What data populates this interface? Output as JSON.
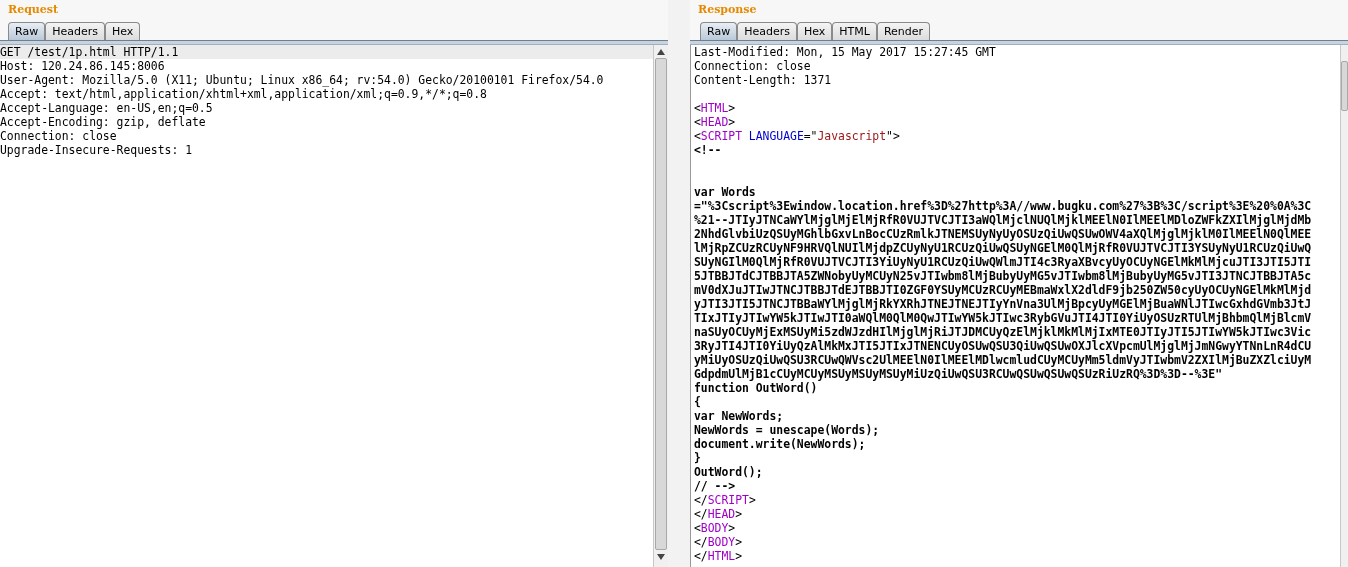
{
  "request": {
    "title": "Request",
    "tabs": [
      {
        "label": "Raw",
        "selected": true
      },
      {
        "label": "Headers",
        "selected": false
      },
      {
        "label": "Hex",
        "selected": false
      }
    ],
    "lines": [
      {
        "kind": "header",
        "highlighted": true,
        "text": "GET /test/1p.html HTTP/1.1"
      },
      {
        "kind": "header",
        "highlighted": false,
        "text": "Host: 120.24.86.145:8006"
      },
      {
        "kind": "header",
        "highlighted": false,
        "text": "User-Agent: Mozilla/5.0 (X11; Ubuntu; Linux x86_64; rv:54.0) Gecko/20100101 Firefox/54.0"
      },
      {
        "kind": "header",
        "highlighted": false,
        "text": "Accept: text/html,application/xhtml+xml,application/xml;q=0.9,*/*;q=0.8"
      },
      {
        "kind": "header",
        "highlighted": false,
        "text": "Accept-Language: en-US,en;q=0.5"
      },
      {
        "kind": "header",
        "highlighted": false,
        "text": "Accept-Encoding: gzip, deflate"
      },
      {
        "kind": "header",
        "highlighted": false,
        "text": "Connection: close"
      },
      {
        "kind": "header",
        "highlighted": false,
        "text": "Upgrade-Insecure-Requests: 1"
      }
    ]
  },
  "response": {
    "title": "Response",
    "tabs": [
      {
        "label": "Raw",
        "selected": true
      },
      {
        "label": "Headers",
        "selected": false
      },
      {
        "label": "Hex",
        "selected": false
      },
      {
        "label": "HTML",
        "selected": false
      },
      {
        "label": "Render",
        "selected": false
      }
    ],
    "lines": [
      {
        "kind": "header",
        "highlighted": false,
        "text": "Last-Modified: Mon, 15 May 2017 15:27:45 GMT"
      },
      {
        "kind": "header",
        "highlighted": false,
        "text": "Connection: close"
      },
      {
        "kind": "header",
        "highlighted": false,
        "text": "Content-Length: 1371"
      },
      {
        "kind": "blank",
        "highlighted": false
      },
      {
        "kind": "markup",
        "highlighted": false,
        "tokens": [
          {
            "kind": "punct",
            "text": "<"
          },
          {
            "kind": "tag",
            "text": "HTML"
          },
          {
            "kind": "punct",
            "text": ">"
          }
        ]
      },
      {
        "kind": "markup",
        "highlighted": false,
        "tokens": [
          {
            "kind": "punct",
            "text": "<"
          },
          {
            "kind": "tag",
            "text": "HEAD"
          },
          {
            "kind": "punct",
            "text": ">"
          }
        ]
      },
      {
        "kind": "markup",
        "highlighted": false,
        "tokens": [
          {
            "kind": "punct",
            "text": "<"
          },
          {
            "kind": "tag",
            "text": "SCRIPT"
          },
          {
            "kind": "attr",
            "text": " LANGUAGE"
          },
          {
            "kind": "punct",
            "text": "=\""
          },
          {
            "kind": "value",
            "text": "Javascript"
          },
          {
            "kind": "punct",
            "text": "\">"
          }
        ]
      },
      {
        "kind": "script",
        "highlighted": false,
        "text": "<!--"
      },
      {
        "kind": "blank",
        "highlighted": false
      },
      {
        "kind": "blank",
        "highlighted": false
      },
      {
        "kind": "script",
        "highlighted": false,
        "text": "var Words"
      },
      {
        "kind": "script",
        "highlighted": false,
        "text": "=\"%3Cscript%3Ewindow.location.href%3D%27http%3A//www.bugku.com%27%3B%3C/script%3E%20%0A%3C"
      },
      {
        "kind": "script",
        "highlighted": false,
        "text": "%21--JTIyJTNCaWYlMjglMjElMjRfR0VUJTVCJTI3aWQlMjclNUQlMjklMEElN0IlMEElMDloZWFkZXIlMjglMjdMb"
      },
      {
        "kind": "script",
        "highlighted": false,
        "text": "2NhdGlvbiUzQSUyMGhlbGxvLnBocCUzRmlkJTNEMSUyNyUyOSUzQiUwQSUwOWV4aXQlMjglMjklM0IlMEElN0QlMEE"
      },
      {
        "kind": "script",
        "highlighted": false,
        "text": "lMjRpZCUzRCUyNF9HRVQlNUIlMjdpZCUyNyU1RCUzQiUwQSUyNGElM0QlMjRfR0VUJTVCJTI3YSUyNyU1RCUzQiUwQ"
      },
      {
        "kind": "script",
        "highlighted": false,
        "text": "SUyNGIlM0QlMjRfR0VUJTVCJTI3YiUyNyU1RCUzQiUwQWlmJTI4c3RyaXBvcyUyOCUyNGElMkMlMjcuJTI3JTI5JTI"
      },
      {
        "kind": "script",
        "highlighted": false,
        "text": "5JTBBJTdCJTBBJTA5ZWNobyUyMCUyN25vJTIwbm8lMjBubyUyMG5vJTIwbm8lMjBubyUyMG5vJTI3JTNCJTBBJTA5c"
      },
      {
        "kind": "script",
        "highlighted": false,
        "text": "mV0dXJuJTIwJTNCJTBBJTdEJTBBJTI0ZGF0YSUyMCUzRCUyMEBmaWxlX2dldF9jb250ZW50cyUyOCUyNGElMkMlMjd"
      },
      {
        "kind": "script",
        "highlighted": false,
        "text": "yJTI3JTI5JTNCJTBBaWYlMjglMjRkYXRhJTNEJTNEJTIyYnVna3UlMjBpcyUyMGElMjBuaWNlJTIwcGxhdGVmb3JtJ"
      },
      {
        "kind": "script",
        "highlighted": false,
        "text": "TIxJTIyJTIwYW5kJTIwJTI0aWQlM0QlM0QwJTIwYW5kJTIwc3RybGVuJTI4JTI0YiUyOSUzRTUlMjBhbmQlMjBlcmV"
      },
      {
        "kind": "script",
        "highlighted": false,
        "text": "naSUyOCUyMjExMSUyMi5zdWJzdHIlMjglMjRiJTJDMCUyQzElMjklMkMlMjIxMTE0JTIyJTI5JTIwYW5kJTIwc3Vic"
      },
      {
        "kind": "script",
        "highlighted": false,
        "text": "3RyJTI4JTI0YiUyQzAlMkMxJTI5JTIxJTNENCUyOSUwQSU3QiUwQSUwOXJlcXVpcmUlMjglMjJmNGwyYTNnLnR4dCU"
      },
      {
        "kind": "script",
        "highlighted": false,
        "text": "yMiUyOSUzQiUwQSU3RCUwQWVsc2UlMEElN0IlMEElMDlwcmludCUyMCUyMm5ldmVyJTIwbmV2ZXIlMjBuZXZlciUyM"
      },
      {
        "kind": "script",
        "highlighted": false,
        "text": "GdpdmUlMjB1cCUyMCUyMSUyMSUyMSUyMiUzQiUwQSU3RCUwQSUwQSUwQSUzRiUzRQ%3D%3D--%3E\""
      },
      {
        "kind": "script",
        "highlighted": false,
        "text": "function OutWord()"
      },
      {
        "kind": "script",
        "highlighted": false,
        "text": "{"
      },
      {
        "kind": "script",
        "highlighted": false,
        "text": "var NewWords;"
      },
      {
        "kind": "script",
        "highlighted": false,
        "text": "NewWords = unescape(Words);"
      },
      {
        "kind": "script",
        "highlighted": false,
        "text": "document.write(NewWords);"
      },
      {
        "kind": "script",
        "highlighted": false,
        "text": "}"
      },
      {
        "kind": "script",
        "highlighted": false,
        "text": "OutWord();"
      },
      {
        "kind": "script",
        "highlighted": false,
        "text": "// -->"
      },
      {
        "kind": "markup",
        "highlighted": false,
        "tokens": [
          {
            "kind": "punct",
            "text": "</"
          },
          {
            "kind": "tag",
            "text": "SCRIPT"
          },
          {
            "kind": "punct",
            "text": ">"
          }
        ]
      },
      {
        "kind": "markup",
        "highlighted": false,
        "tokens": [
          {
            "kind": "punct",
            "text": "</"
          },
          {
            "kind": "tag",
            "text": "HEAD"
          },
          {
            "kind": "punct",
            "text": ">"
          }
        ]
      },
      {
        "kind": "markup",
        "highlighted": false,
        "tokens": [
          {
            "kind": "punct",
            "text": "<"
          },
          {
            "kind": "tag",
            "text": "BODY"
          },
          {
            "kind": "punct",
            "text": ">"
          }
        ]
      },
      {
        "kind": "markup",
        "highlighted": false,
        "tokens": [
          {
            "kind": "punct",
            "text": "</"
          },
          {
            "kind": "tag",
            "text": "BODY"
          },
          {
            "kind": "punct",
            "text": ">"
          }
        ]
      },
      {
        "kind": "markup",
        "highlighted": false,
        "tokens": [
          {
            "kind": "punct",
            "text": "</"
          },
          {
            "kind": "tag",
            "text": "HTML"
          },
          {
            "kind": "punct",
            "text": ">"
          }
        ]
      }
    ]
  }
}
